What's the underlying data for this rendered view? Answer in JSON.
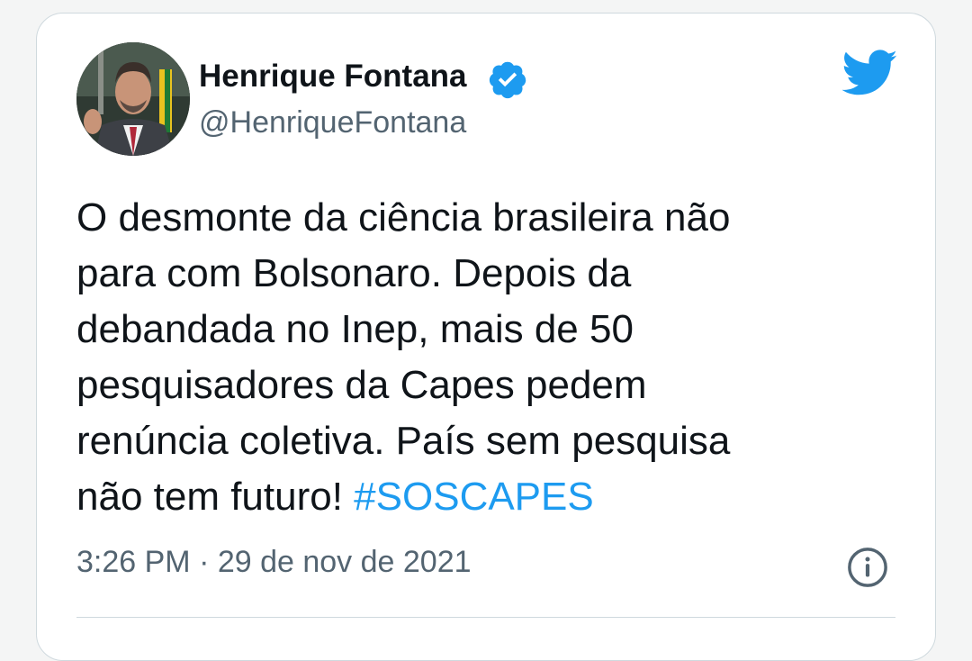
{
  "tweet": {
    "author": {
      "display_name": "Henrique Fontana",
      "handle": "@HenriqueFontana",
      "verified": true,
      "avatar_icon": "avatar-photo"
    },
    "text_lines": [
      "O desmonte da ciência brasileira não",
      "para com Bolsonaro. Depois da",
      "debandada no Inep, mais de 50",
      "pesquisadores da Capes pedem",
      "renúncia coletiva. País sem pesquisa",
      "não tem futuro! "
    ],
    "hashtag": "#SOSCAPES",
    "timestamp": "3:26 PM · 29 de nov de 2021"
  },
  "icons": {
    "brand": "twitter-bird-icon",
    "verified": "verified-badge-icon",
    "info": "info-icon"
  },
  "colors": {
    "accent": "#1d9bf0",
    "text": "#0f1419",
    "secondary": "#536471",
    "border": "#cfd9de"
  }
}
